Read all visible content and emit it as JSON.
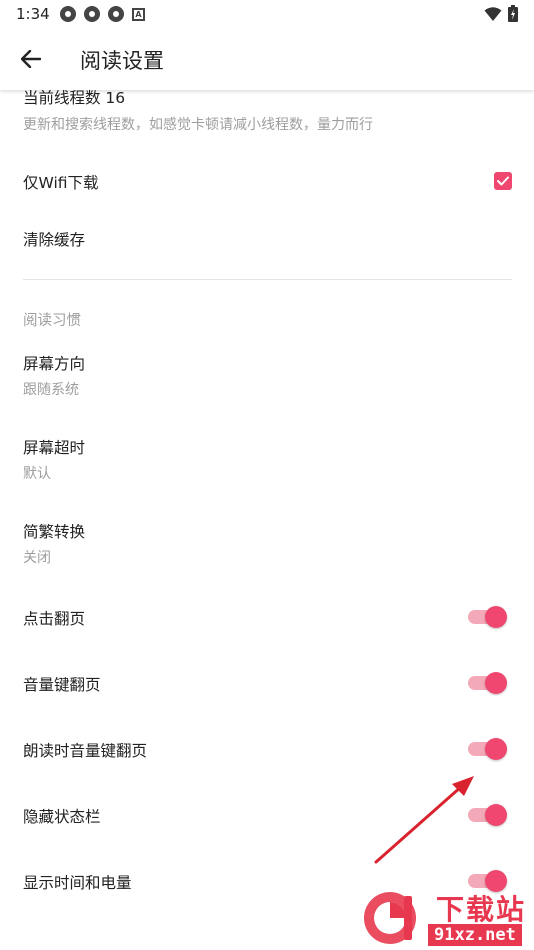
{
  "status_bar": {
    "time": "1:34",
    "badge_letter": "A"
  },
  "app_bar": {
    "title": "阅读设置"
  },
  "settings": {
    "thread_count": {
      "title": "当前线程数 16",
      "subtitle": "更新和搜索线程数，如感觉卡顿请减小线程数，量力而行"
    },
    "wifi_only": {
      "title": "仅Wifi下载",
      "checked": true
    },
    "clear_cache": {
      "title": "清除缓存"
    },
    "section_reading": "阅读习惯",
    "screen_orientation": {
      "title": "屏幕方向",
      "value": "跟随系统"
    },
    "screen_timeout": {
      "title": "屏幕超时",
      "value": "默认"
    },
    "chinese_conversion": {
      "title": "简繁转换",
      "value": "关闭"
    },
    "tap_page_turn": {
      "title": "点击翻页",
      "enabled": true
    },
    "volume_key_turn": {
      "title": "音量键翻页",
      "enabled": true
    },
    "tts_volume_key_turn": {
      "title": "朗读时音量键翻页",
      "enabled": true
    },
    "hide_status_bar": {
      "title": "隐藏状态栏",
      "enabled": true
    },
    "show_time_battery": {
      "title": "显示时间和电量",
      "enabled": true
    }
  },
  "colors": {
    "accent": "#ef476f",
    "accent_light": "#f4a9b8",
    "secondary_text": "#9e9e9e",
    "annotation_arrow": "#d9232e"
  },
  "watermark": {
    "title": "下载站",
    "url": "91xz.net"
  }
}
